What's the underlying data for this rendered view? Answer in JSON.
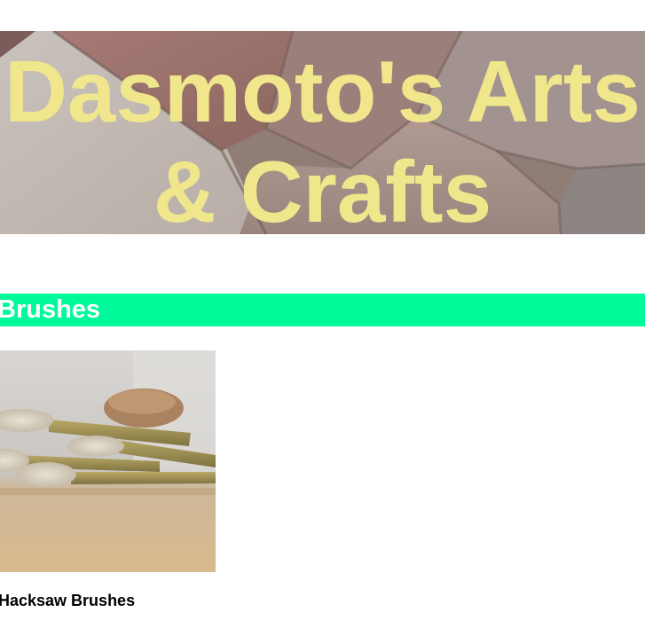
{
  "header": {
    "title_line_1": "Dasmoto's Arts",
    "title_line_2": "& Crafts",
    "title_color": "#f0e68c",
    "background": "brick-pavement-photo"
  },
  "sections": [
    {
      "heading": "Brushes",
      "heading_color": "#ffffff",
      "heading_background": "#00fa9a",
      "products": [
        {
          "image": "paint-brushes-photo",
          "caption": "Hacksaw Brushes"
        }
      ]
    }
  ]
}
